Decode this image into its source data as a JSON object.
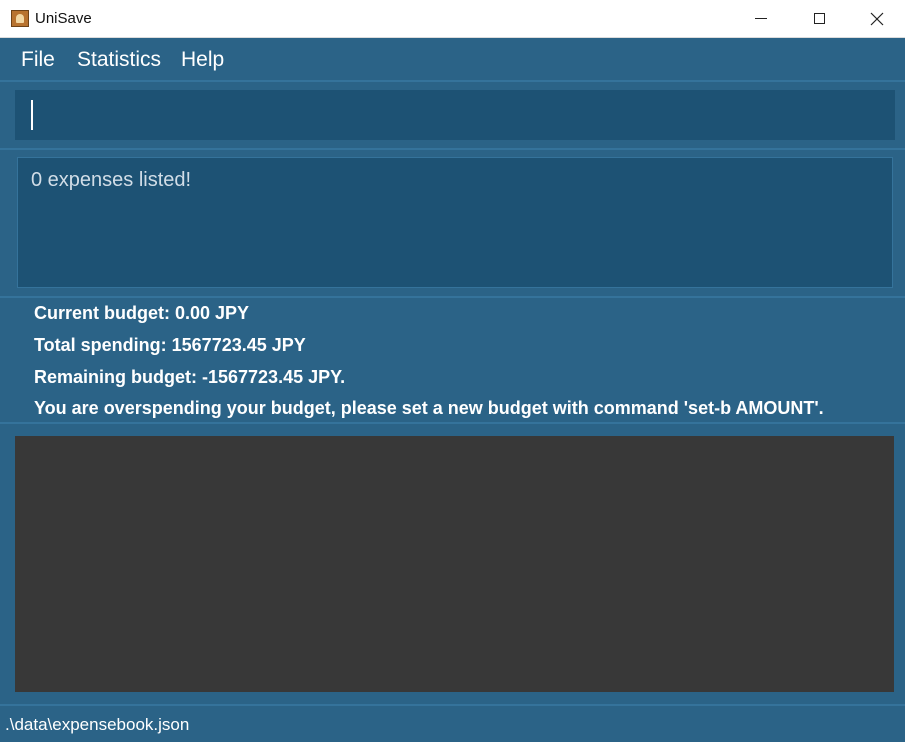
{
  "window": {
    "title": "UniSave",
    "icon": "app-icon",
    "controls": {
      "minimize": "minimize-icon",
      "maximize": "maximize-icon",
      "close": "close-icon",
      "close_glyph": "✕"
    }
  },
  "menu": {
    "items": [
      {
        "label": "File"
      },
      {
        "label": "Statistics"
      },
      {
        "label": "Help"
      }
    ]
  },
  "command": {
    "value": "",
    "placeholder": ""
  },
  "result": {
    "message": "0 expenses listed!"
  },
  "budget": {
    "current": "Current budget: 0.00 JPY",
    "total_spending": "Total spending: 1567723.45 JPY",
    "remaining": "Remaining budget: -1567723.45 JPY.",
    "warning": "You are overspending your budget, please set a new budget with command 'set-b AMOUNT'."
  },
  "expense_list": {
    "items": []
  },
  "status": {
    "file_path": ".\\data\\expensebook.json"
  },
  "colors": {
    "background": "#2b6387",
    "panel": "#1d5274",
    "list_background": "#383838",
    "text": "#ffffff"
  }
}
